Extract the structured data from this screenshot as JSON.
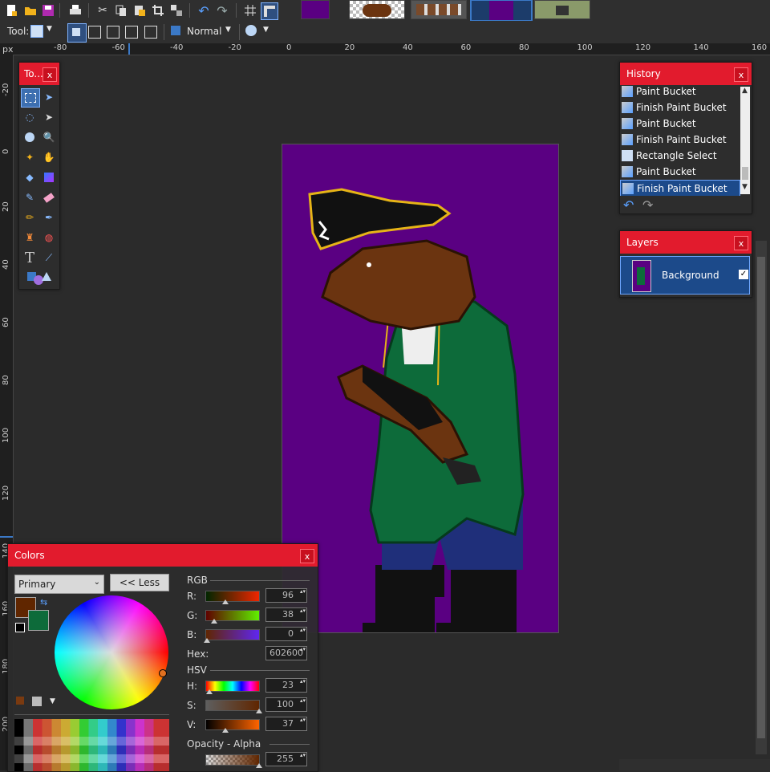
{
  "toolbar": {
    "blend_mode": "Normal",
    "tool_label": "Tool:",
    "icons": [
      "new-icon",
      "open-icon",
      "save-icon",
      "print-icon",
      "cut-icon",
      "copy-icon",
      "paste-icon",
      "crop-icon",
      "resize-icon",
      "undo-icon",
      "redo-icon",
      "grid-icon",
      "rulers-icon"
    ],
    "image_tabs": [
      "image-1",
      "image-2",
      "image-3",
      "image-4",
      "image-5"
    ]
  },
  "rulers": {
    "unit": "px",
    "horizontal_labels": [
      "-80",
      "-60",
      "-40",
      "-20",
      "0",
      "20",
      "40",
      "60",
      "80",
      "100",
      "120",
      "140",
      "160"
    ],
    "vertical_labels": [
      "-20",
      "0",
      "20",
      "40",
      "60",
      "80",
      "100",
      "120",
      "140",
      "160",
      "180",
      "200"
    ]
  },
  "tools_panel": {
    "title": "To...",
    "close": "x"
  },
  "history": {
    "title": "History",
    "close": "x",
    "items": [
      {
        "label": "Paint Bucket",
        "icon": "paint-bucket-icon"
      },
      {
        "label": "Finish Paint Bucket",
        "icon": "paint-bucket-icon"
      },
      {
        "label": "Paint Bucket",
        "icon": "paint-bucket-icon"
      },
      {
        "label": "Finish Paint Bucket",
        "icon": "paint-bucket-icon"
      },
      {
        "label": "Rectangle Select",
        "icon": "rectangle-select-icon"
      },
      {
        "label": "Paint Bucket",
        "icon": "paint-bucket-icon"
      },
      {
        "label": "Finish Paint Bucket",
        "icon": "paint-bucket-icon"
      }
    ],
    "selected_index": 6
  },
  "layers": {
    "title": "Layers",
    "close": "x",
    "items": [
      {
        "name": "Background",
        "visible": true
      }
    ]
  },
  "colors": {
    "title": "Colors",
    "close": "x",
    "mode_select": "Primary",
    "less_button": "<< Less",
    "rgb_header": "RGB",
    "hsv_header": "HSV",
    "r_label": "R:",
    "g_label": "G:",
    "b_label": "B:",
    "h_label": "H:",
    "s_label": "S:",
    "v_label": "V:",
    "hex_label": "Hex:",
    "alpha_header": "Opacity - Alpha",
    "r": "96",
    "g": "38",
    "b": "0",
    "hex": "602600",
    "h": "23",
    "s": "100",
    "v": "37",
    "alpha": "255",
    "primary_color": "#602600",
    "secondary_color": "#0d6b3a"
  },
  "accent": {
    "title_red": "#e21b2d",
    "selection_blue": "#1c4a8a",
    "canvas_bg": "#5a0082"
  }
}
